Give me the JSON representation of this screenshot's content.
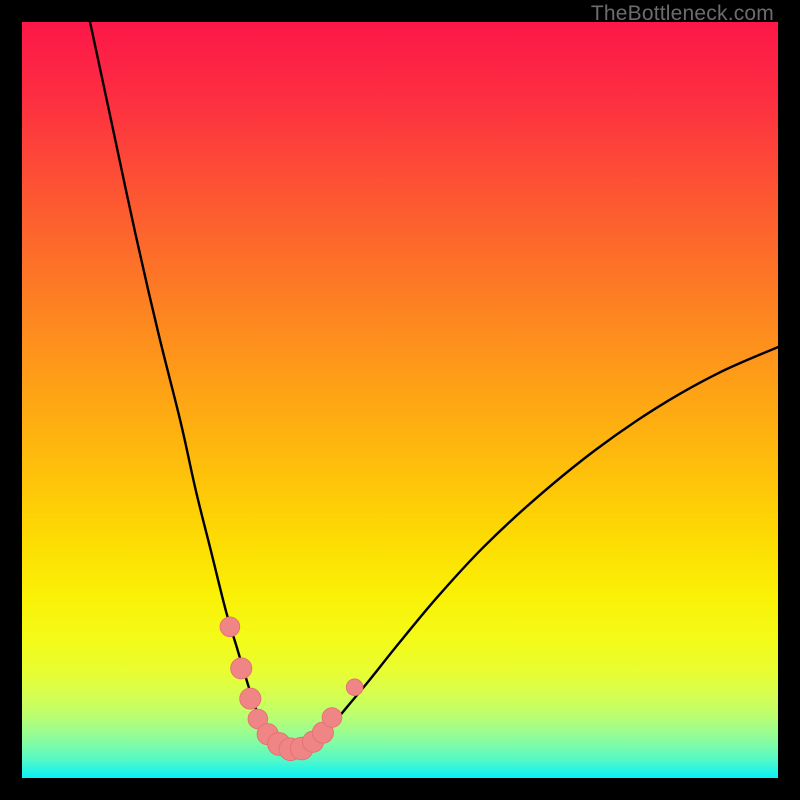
{
  "watermark": "TheBottleneck.com",
  "colors": {
    "frame": "#000000",
    "curve": "#000000",
    "marker_fill": "#ef8585",
    "marker_stroke": "#e86f6f",
    "gradient_stops": [
      {
        "offset": 0.0,
        "color": "#fc1748"
      },
      {
        "offset": 0.1,
        "color": "#fd2e41"
      },
      {
        "offset": 0.22,
        "color": "#fd5333"
      },
      {
        "offset": 0.35,
        "color": "#fd7a25"
      },
      {
        "offset": 0.48,
        "color": "#fea016"
      },
      {
        "offset": 0.58,
        "color": "#febc0c"
      },
      {
        "offset": 0.68,
        "color": "#fdda03"
      },
      {
        "offset": 0.76,
        "color": "#faf106"
      },
      {
        "offset": 0.82,
        "color": "#f3fb1a"
      },
      {
        "offset": 0.86,
        "color": "#e8fd33"
      },
      {
        "offset": 0.89,
        "color": "#d6fe50"
      },
      {
        "offset": 0.915,
        "color": "#befe6d"
      },
      {
        "offset": 0.935,
        "color": "#a2fd89"
      },
      {
        "offset": 0.955,
        "color": "#80fca6"
      },
      {
        "offset": 0.975,
        "color": "#56f9c6"
      },
      {
        "offset": 0.99,
        "color": "#28f4e4"
      },
      {
        "offset": 1.0,
        "color": "#0af0f7"
      }
    ]
  },
  "chart_data": {
    "type": "line",
    "title": "",
    "xlabel": "",
    "ylabel": "",
    "x_range": [
      0,
      100
    ],
    "y_range": [
      0,
      100
    ],
    "note": "Two steep curves descending into a narrow valley near x≈35; left curve starts near (9,100) and right curve ends near (100,57). Valley floor near y≈3–6 between x≈30 and x≈40. Salmon markers cluster around the valley.",
    "series": [
      {
        "name": "left_curve",
        "x": [
          9,
          12,
          15,
          18,
          21,
          23,
          25,
          27,
          28.5,
          30,
          31,
          32,
          33,
          34,
          35,
          35.5
        ],
        "y": [
          100,
          86,
          72,
          59,
          47,
          38,
          30,
          22,
          17,
          12,
          9,
          7,
          5.5,
          4.5,
          3.7,
          3.3
        ]
      },
      {
        "name": "right_curve",
        "x": [
          35.5,
          36.5,
          38,
          39.5,
          41,
          43,
          46,
          50,
          55,
          61,
          68,
          76,
          84,
          92,
          100
        ],
        "y": [
          3.3,
          3.6,
          4.3,
          5.5,
          7.0,
          9.4,
          13,
          18,
          24,
          30.5,
          37,
          43.5,
          49,
          53.5,
          57
        ]
      }
    ],
    "markers": [
      {
        "x": 27.5,
        "y": 20.0,
        "r": 1.3
      },
      {
        "x": 29.0,
        "y": 14.5,
        "r": 1.4
      },
      {
        "x": 30.2,
        "y": 10.5,
        "r": 1.4
      },
      {
        "x": 31.2,
        "y": 7.8,
        "r": 1.3
      },
      {
        "x": 32.5,
        "y": 5.8,
        "r": 1.4
      },
      {
        "x": 34.0,
        "y": 4.5,
        "r": 1.5
      },
      {
        "x": 35.5,
        "y": 3.8,
        "r": 1.5
      },
      {
        "x": 37.0,
        "y": 3.9,
        "r": 1.5
      },
      {
        "x": 38.5,
        "y": 4.8,
        "r": 1.4
      },
      {
        "x": 39.8,
        "y": 6.0,
        "r": 1.4
      },
      {
        "x": 41.0,
        "y": 8.0,
        "r": 1.3
      },
      {
        "x": 44.0,
        "y": 12.0,
        "r": 1.1
      }
    ]
  }
}
